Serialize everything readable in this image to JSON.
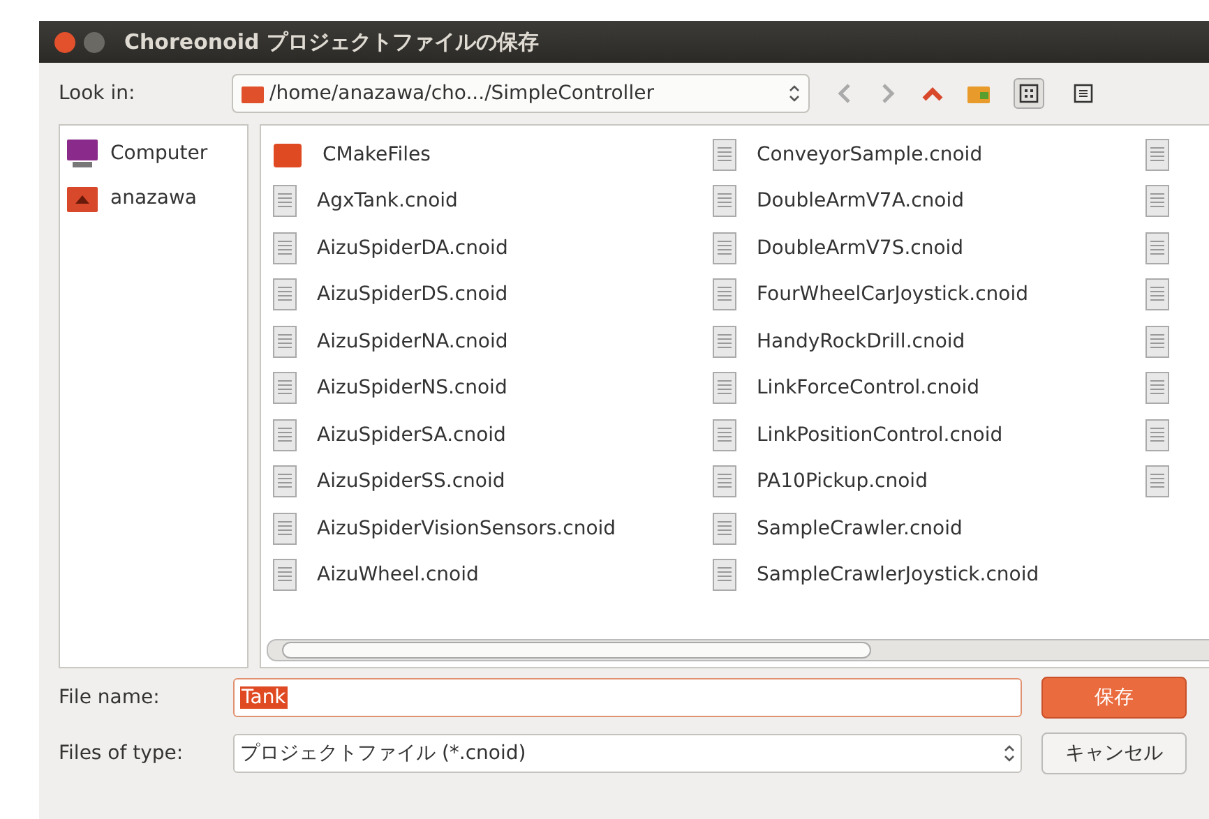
{
  "window": {
    "title": "Choreonoid プロジェクトファイルの保存"
  },
  "look_in": {
    "label": "Look in:",
    "path": "/home/anazawa/cho.../SimpleController"
  },
  "toolbar": [
    {
      "kind": "back",
      "disabled": true
    },
    {
      "kind": "forward",
      "disabled": true
    },
    {
      "kind": "up",
      "disabled": false
    },
    {
      "kind": "new-folder",
      "disabled": false
    },
    {
      "kind": "icon-view",
      "selected": true
    },
    {
      "kind": "list-view",
      "selected": false
    }
  ],
  "places": [
    {
      "kind": "computer",
      "label": "Computer"
    },
    {
      "kind": "home",
      "label": "anazawa"
    }
  ],
  "files": [
    [
      {
        "kind": "folder",
        "name": "CMakeFiles"
      },
      {
        "kind": "file",
        "name": "AgxTank.cnoid"
      },
      {
        "kind": "file",
        "name": "AizuSpiderDA.cnoid"
      },
      {
        "kind": "file",
        "name": "AizuSpiderDS.cnoid"
      },
      {
        "kind": "file",
        "name": "AizuSpiderNA.cnoid"
      },
      {
        "kind": "file",
        "name": "AizuSpiderNS.cnoid"
      },
      {
        "kind": "file",
        "name": "AizuSpiderSA.cnoid"
      },
      {
        "kind": "file",
        "name": "AizuSpiderSS.cnoid"
      },
      {
        "kind": "file",
        "name": "AizuSpiderVisionSensors.cnoid"
      },
      {
        "kind": "file",
        "name": "AizuWheel.cnoid"
      }
    ],
    [
      {
        "kind": "file",
        "name": "ConveyorSample.cnoid"
      },
      {
        "kind": "file",
        "name": "DoubleArmV7A.cnoid"
      },
      {
        "kind": "file",
        "name": "DoubleArmV7S.cnoid"
      },
      {
        "kind": "file",
        "name": "FourWheelCarJoystick.cnoid"
      },
      {
        "kind": "file",
        "name": "HandyRockDrill.cnoid"
      },
      {
        "kind": "file",
        "name": "LinkForceControl.cnoid"
      },
      {
        "kind": "file",
        "name": "LinkPositionControl.cnoid"
      },
      {
        "kind": "file",
        "name": "PA10Pickup.cnoid"
      },
      {
        "kind": "file",
        "name": "SampleCrawler.cnoid"
      },
      {
        "kind": "file",
        "name": "SampleCrawlerJoystick.cnoid"
      }
    ],
    [
      {
        "kind": "file"
      },
      {
        "kind": "file"
      },
      {
        "kind": "file"
      },
      {
        "kind": "file"
      },
      {
        "kind": "file"
      },
      {
        "kind": "file"
      },
      {
        "kind": "file"
      },
      {
        "kind": "file"
      }
    ]
  ],
  "file_name": {
    "label": "File name:",
    "value": "Tank"
  },
  "file_type": {
    "label": "Files of type:",
    "value": "プロジェクトファイル (*.cnoid)"
  },
  "buttons": [
    {
      "kind": "primary",
      "label": "保存"
    },
    {
      "kind": "normal",
      "label": "キャンセル"
    }
  ]
}
